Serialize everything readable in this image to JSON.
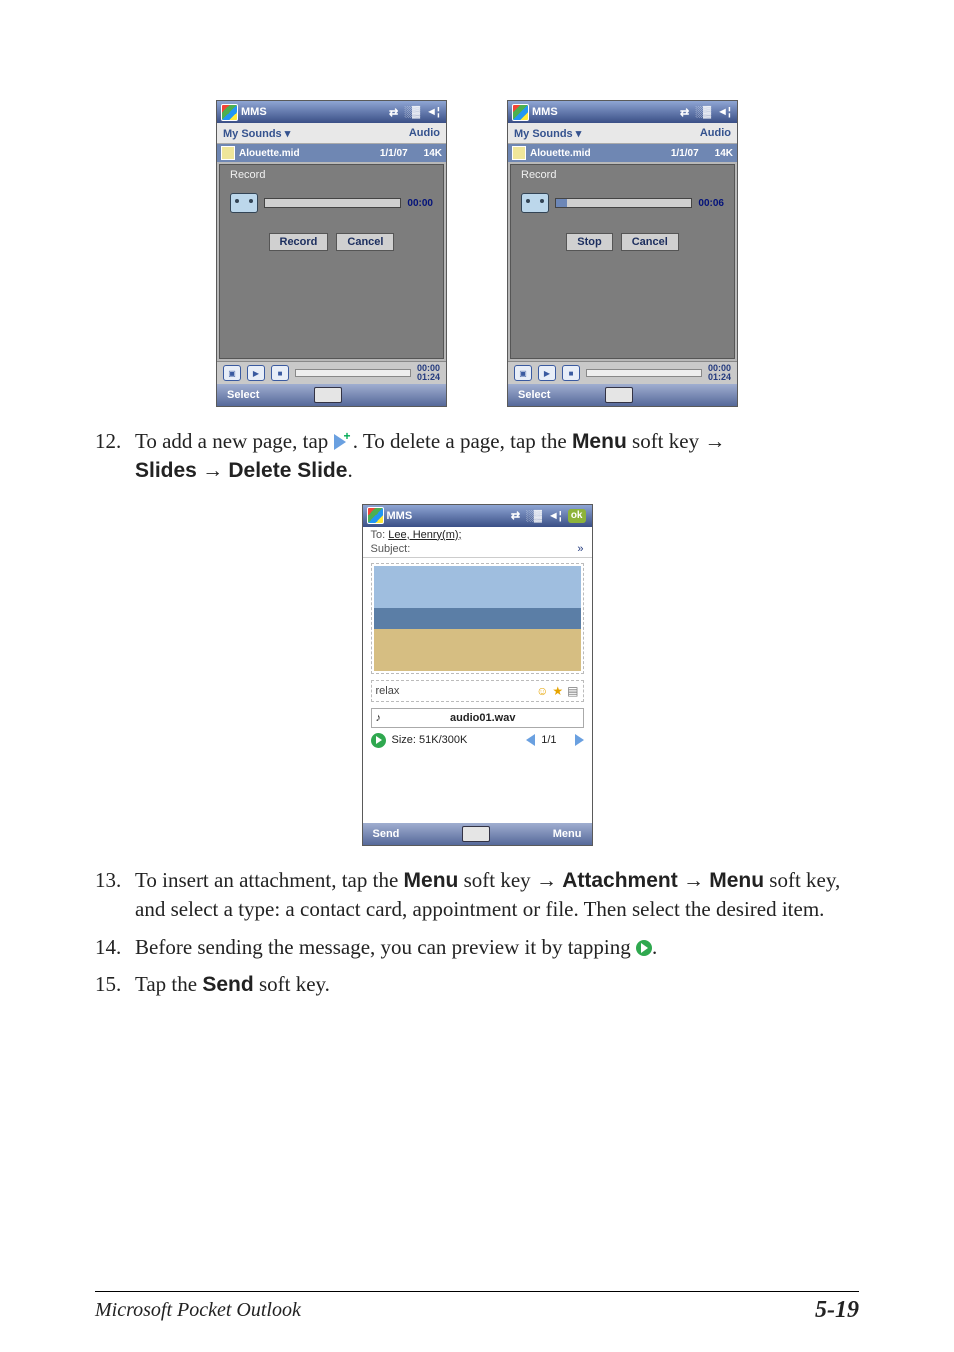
{
  "phone_a": {
    "title": "MMS",
    "subbar_left": "My Sounds",
    "subbar_right": "Audio",
    "file_name": "Alouette.mid",
    "file_date": "1/1/07",
    "file_size": "14K",
    "panel_title": "Record",
    "time": "00:00",
    "btn_primary": "Record",
    "btn_secondary": "Cancel",
    "player_time_top": "00:00",
    "player_time_bottom": "01:24",
    "softkey_left": "Select"
  },
  "phone_b": {
    "title": "MMS",
    "subbar_left": "My Sounds",
    "subbar_right": "Audio",
    "file_name": "Alouette.mid",
    "file_date": "1/1/07",
    "file_size": "14K",
    "panel_title": "Record",
    "time": "00:06",
    "btn_primary": "Stop",
    "btn_secondary": "Cancel",
    "player_time_top": "00:00",
    "player_time_bottom": "01:24",
    "softkey_left": "Select"
  },
  "step12": {
    "num": "12.",
    "t1": "To add a new page, tap ",
    "t2": ". To delete a page, tap the ",
    "menu": "Menu",
    "t3": " soft key ",
    "slides": "Slides",
    "delete_slide": "Delete Slide",
    "period": "."
  },
  "phone_c": {
    "title": "MMS",
    "ok": "ok",
    "to_label": "To:",
    "to_value": "Lee, Henry(m);",
    "subject_label": "Subject:",
    "text_content": "relax",
    "audio_file": "audio01.wav",
    "size": "Size: 51K/300K",
    "page_indicator": "1/1",
    "softkey_left": "Send",
    "softkey_right": "Menu"
  },
  "step13": {
    "num": "13.",
    "t1": "To insert an attachment, tap the ",
    "menu": "Menu",
    "t2": " soft key ",
    "attachment": "Attachment",
    "t3": " soft key, and select a type: a contact card, appointment or file. Then select the desired item."
  },
  "step14": {
    "num": "14.",
    "t1": "Before sending the message, you can preview it by tapping ",
    "t2": "."
  },
  "step15": {
    "num": "15.",
    "t1": "Tap the ",
    "send": "Send",
    "t2": " soft key."
  },
  "footer": {
    "left": "Microsoft Pocket Outlook",
    "right": "5-19"
  },
  "glyphs": {
    "arrow": "→",
    "dropdown": "▾",
    "sync": "⇄",
    "signal": "░▓",
    "speaker": "◄¦",
    "note": "♪",
    "smile": "☺",
    "star": "★",
    "card": "▤",
    "chev_down": "»",
    "play": "▶",
    "stop": "■",
    "prev": "◀",
    "mms_box": "▣"
  }
}
